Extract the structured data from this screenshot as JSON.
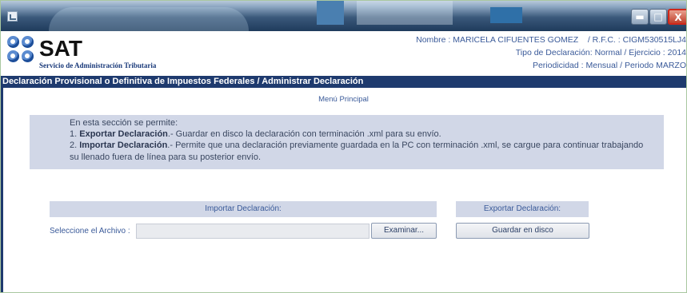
{
  "window": {
    "minimize_symbol": "▬",
    "maximize_symbol": "□",
    "close_symbol": "X"
  },
  "header": {
    "logo_text": "SAT",
    "logo_subtitle": "Servicio de Administración Tributaria",
    "nombre_label": "Nombre :",
    "nombre_value": "MARICELA CIFUENTES GOMEZ",
    "rfc_label": "/ R.F.C. :",
    "rfc_value": "CIGM530515LJ4",
    "tipo_label": "Tipo de Declaración:",
    "tipo_value": "Normal",
    "ejercicio_label": "/ Ejercicio :",
    "ejercicio_value": "2014",
    "periodicidad_label": "Periodicidad :",
    "periodicidad_value": "Mensual",
    "periodo_label": "/ Periodo",
    "periodo_value": "MARZO"
  },
  "nav_bar_text": "Declaración Provisional o Definitiva de Impuestos Federales / Administrar Declaración",
  "menu_title": "Menú Principal",
  "info": {
    "intro": "En esta sección se permite:",
    "item1_num": "1.",
    "item1_title": "Exportar Declaración",
    "item1_text": ".- Guardar en disco la declaración con terminación .xml para su envío.",
    "item2_num": "2.",
    "item2_title": "Importar Declaración",
    "item2_text": ".- Permite que una declaración previamente guardada en la PC con terminación .xml, se cargue para continuar trabajando",
    "item2_cont": "su llenado fuera de línea para su posterior envío."
  },
  "import_section": {
    "header": "Importar Declaración:",
    "label": "Seleccione el Archivo :",
    "file_value": "",
    "browse_button": "Examinar..."
  },
  "export_section": {
    "header": "Exportar Declaración:",
    "save_button": "Guardar en disco"
  },
  "colors": {
    "nav_bar": "#1e3a6e",
    "info_box": "#d1d7e7",
    "label_text": "#3a5a99",
    "close_button": "#c13f2a"
  }
}
